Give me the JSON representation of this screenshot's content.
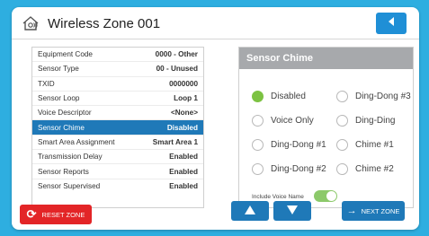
{
  "header": {
    "title": "Wireless Zone 001",
    "back_icon": "back-arrow-icon"
  },
  "zone_icon": "zone-chime-icon",
  "settings": [
    {
      "label": "Equipment Code",
      "value": "0000 - Other",
      "selected": false
    },
    {
      "label": "Sensor Type",
      "value": "00 - Unused",
      "selected": false
    },
    {
      "label": "TXID",
      "value": "0000000",
      "selected": false
    },
    {
      "label": "Sensor Loop",
      "value": "Loop 1",
      "selected": false
    },
    {
      "label": "Voice Descriptor",
      "value": "<None>",
      "selected": false
    },
    {
      "label": "Sensor Chime",
      "value": "Disabled",
      "selected": true
    },
    {
      "label": "Smart Area Assignment",
      "value": "Smart Area 1",
      "selected": false
    },
    {
      "label": "Transmission Delay",
      "value": "Enabled",
      "selected": false
    },
    {
      "label": "Sensor Reports",
      "value": "Enabled",
      "selected": false
    },
    {
      "label": "Sensor Supervised",
      "value": "Enabled",
      "selected": false
    }
  ],
  "chime": {
    "title": "Sensor Chime",
    "options": [
      {
        "label": "Disabled",
        "checked": true
      },
      {
        "label": "Ding-Dong #3",
        "checked": false
      },
      {
        "label": "Voice Only",
        "checked": false
      },
      {
        "label": "Ding-Ding",
        "checked": false
      },
      {
        "label": "Ding-Dong #1",
        "checked": false
      },
      {
        "label": "Chime #1",
        "checked": false
      },
      {
        "label": "Ding-Dong #2",
        "checked": false
      },
      {
        "label": "Chime #2",
        "checked": false
      }
    ],
    "include_voice_label": "Include Voice Name",
    "include_voice_on": true
  },
  "footer": {
    "reset_label": "RESET ZONE",
    "next_label": "NEXT ZONE",
    "up_icon": "up-arrow-icon",
    "down_icon": "down-arrow-icon"
  },
  "colors": {
    "background": "#2eaee0",
    "primary": "#1f79b8",
    "danger": "#e32527",
    "selected_radio": "#7cc242",
    "chime_header": "#a7a9ac"
  }
}
